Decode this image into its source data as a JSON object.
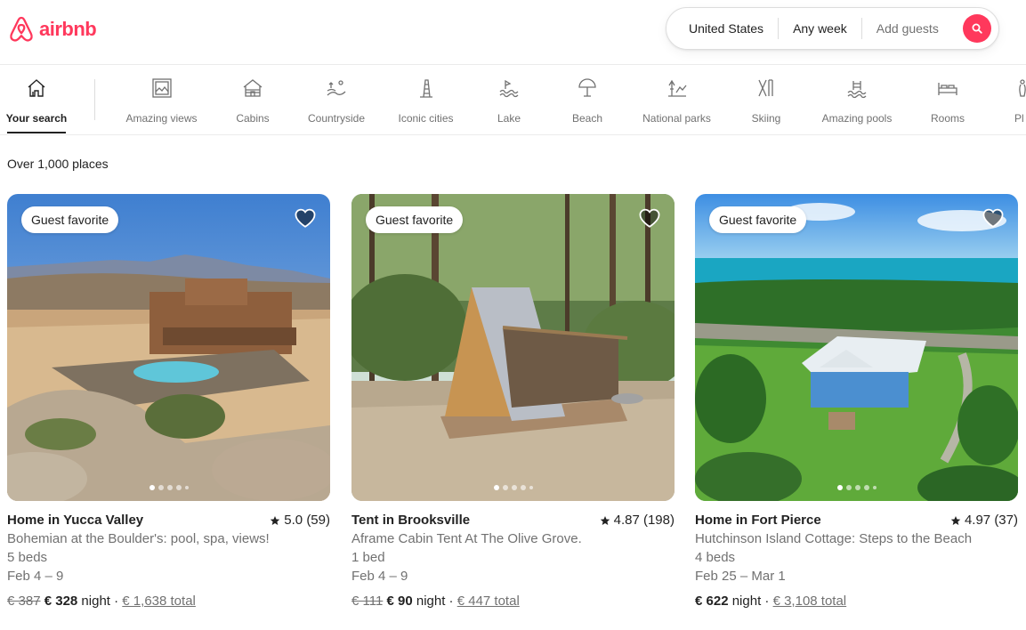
{
  "brand": {
    "name": "airbnb",
    "color": "#ff385c"
  },
  "search": {
    "location": "United States",
    "dates": "Any week",
    "guests": "Add guests",
    "icon": "search-icon"
  },
  "categories": [
    {
      "label": "Your search",
      "icon": "home-icon",
      "active": true
    },
    {
      "label": "Amazing views",
      "icon": "framed-view-icon"
    },
    {
      "label": "Cabins",
      "icon": "cabin-icon"
    },
    {
      "label": "Countryside",
      "icon": "countryside-icon"
    },
    {
      "label": "Iconic cities",
      "icon": "tower-icon"
    },
    {
      "label": "Lake",
      "icon": "lake-icon"
    },
    {
      "label": "Beach",
      "icon": "umbrella-icon"
    },
    {
      "label": "National parks",
      "icon": "park-icon"
    },
    {
      "label": "Skiing",
      "icon": "skiing-icon"
    },
    {
      "label": "Amazing pools",
      "icon": "pool-icon"
    },
    {
      "label": "Rooms",
      "icon": "bed-icon"
    },
    {
      "label": "Pl",
      "icon": "bowling-icon"
    }
  ],
  "results_count": "Over 1,000 places",
  "listings": [
    {
      "badge": "Guest favorite",
      "title": "Home in Yucca Valley",
      "rating": "5.0 (59)",
      "description": "Bohemian at the Boulder's: pool, spa, views!",
      "beds": "5 beds",
      "dates": "Feb 4 – 9",
      "old_price": "€ 387",
      "price": "€ 328",
      "unit": " night · ",
      "total": "€ 1,638 total"
    },
    {
      "badge": "Guest favorite",
      "title": "Tent in Brooksville",
      "rating": "4.87 (198)",
      "description": "Aframe Cabin Tent At The Olive Grove.",
      "beds": "1 bed",
      "dates": "Feb 4 – 9",
      "old_price": "€ 111",
      "price": "€ 90",
      "unit": " night · ",
      "total": "€ 447 total"
    },
    {
      "badge": "Guest favorite",
      "title": "Home in Fort Pierce",
      "rating": "4.97 (37)",
      "description": "Hutchinson Island Cottage: Steps to the Beach",
      "beds": "4 beds",
      "dates": "Feb 25 – Mar 1",
      "old_price": "",
      "price": "€ 622",
      "unit": " night · ",
      "total": "€ 3,108 total"
    }
  ]
}
